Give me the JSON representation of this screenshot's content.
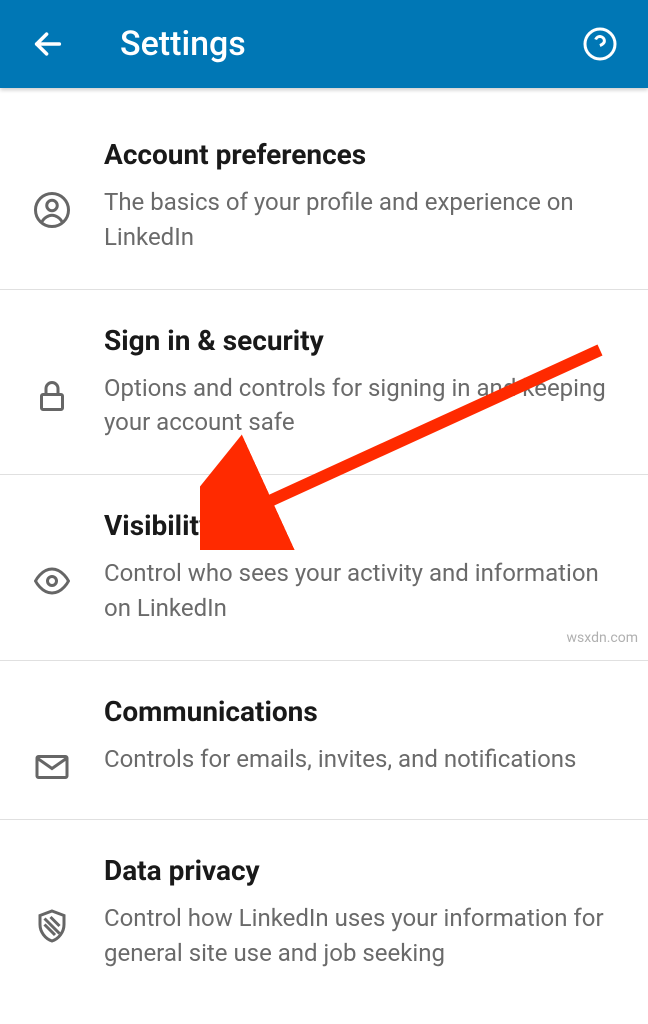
{
  "header": {
    "title": "Settings"
  },
  "sections": [
    {
      "title": "Account preferences",
      "desc": "The basics of your profile and experience on LinkedIn"
    },
    {
      "title": "Sign in & security",
      "desc": "Options and controls for signing in and keeping your account safe"
    },
    {
      "title": "Visibility",
      "desc": "Control who sees your activity and information on LinkedIn"
    },
    {
      "title": "Communications",
      "desc": "Controls for emails, invites, and notifications"
    },
    {
      "title": "Data privacy",
      "desc": "Control how LinkedIn uses your information for general site use and job seeking"
    }
  ],
  "watermark": "wsxdn.com"
}
